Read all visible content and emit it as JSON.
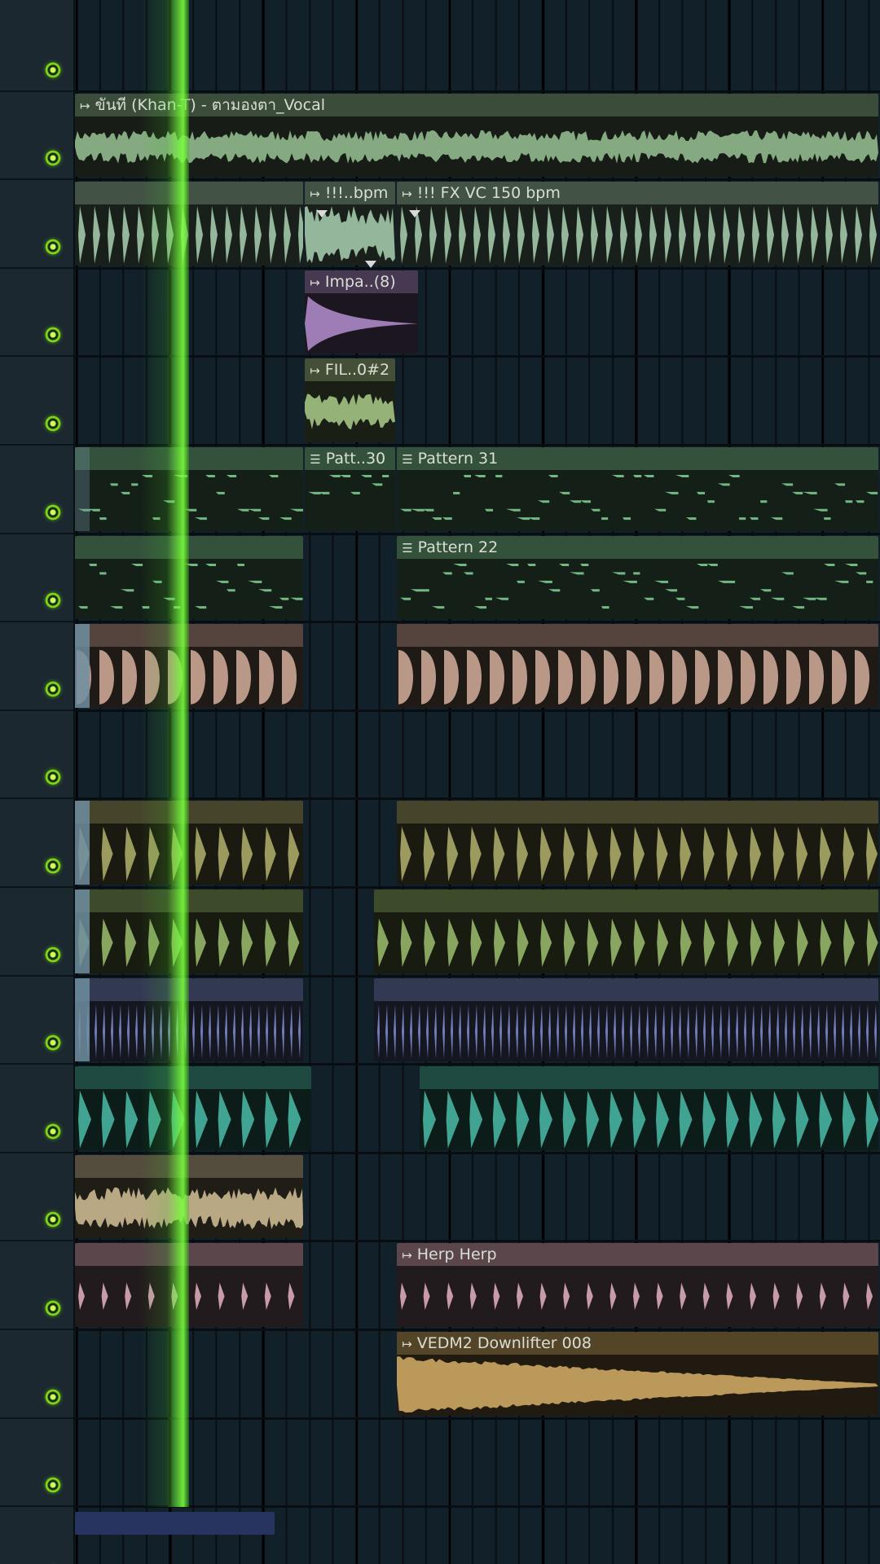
{
  "window": {
    "title": ""
  },
  "colors": {
    "vocal": "#8fb58a",
    "fx": "#9ec3a5",
    "impact": "#a987c4",
    "filter": "#9fbf82",
    "pattern_notes": "#7cc48d",
    "clap": "#c7a392",
    "kick": "#a6a566",
    "snare": "#93b266",
    "hat": "#7c87c6",
    "perc": "#47b09c",
    "noise": "#c7b48e",
    "herp": "#d6a6b3",
    "downlifter": "#c9a462",
    "playhead": "#5fe030"
  },
  "tracks": [
    {
      "clips": []
    },
    {
      "clips": [
        {
          "label": "ขันที (Khan-T) - ตามองตา_Vocal",
          "icon": "audio-clip-icon",
          "start": 0,
          "end": 1,
          "color": "vocal"
        }
      ]
    },
    {
      "clips": [
        {
          "label": "",
          "icon": "audio-clip-icon",
          "start": 0,
          "end": 0.2857,
          "color": "fx"
        },
        {
          "label": "!!!..bpm",
          "icon": "audio-clip-icon",
          "start": 0.2857,
          "end": 0.4,
          "color": "fx"
        },
        {
          "label": "!!! FX VC 150 bpm",
          "icon": "audio-clip-icon",
          "start": 0.4,
          "end": 1,
          "color": "fx"
        }
      ]
    },
    {
      "clips": [
        {
          "label": "Impa..(8)",
          "icon": "audio-clip-icon",
          "start": 0.2857,
          "end": 0.4286,
          "color": "impact"
        }
      ]
    },
    {
      "clips": [
        {
          "label": "FIL..0#2",
          "icon": "audio-clip-icon",
          "start": 0.2857,
          "end": 0.4,
          "color": "filter"
        }
      ]
    },
    {
      "clips": [
        {
          "label": "",
          "icon": "pattern-clip-icon",
          "start": 0,
          "end": 0.2857,
          "color": "pattern_notes"
        },
        {
          "label": "Patt..30",
          "icon": "pattern-clip-icon",
          "start": 0.2857,
          "end": 0.4,
          "color": "pattern_notes"
        },
        {
          "label": "Pattern 31",
          "icon": "pattern-clip-icon",
          "start": 0.4,
          "end": 1,
          "color": "pattern_notes"
        }
      ]
    },
    {
      "clips": [
        {
          "label": "",
          "icon": "pattern-clip-icon",
          "start": 0,
          "end": 0.2857,
          "color": "pattern_notes"
        },
        {
          "label": "Pattern 22",
          "icon": "pattern-clip-icon",
          "start": 0.4,
          "end": 1,
          "color": "pattern_notes"
        }
      ]
    },
    {
      "clips": [
        {
          "label": "",
          "icon": "audio-clip-icon",
          "start": 0,
          "end": 0.2857,
          "color": "clap"
        },
        {
          "label": "",
          "icon": "audio-clip-icon",
          "start": 0.4,
          "end": 1,
          "color": "clap"
        }
      ]
    },
    {
      "clips": []
    },
    {
      "clips": [
        {
          "label": "",
          "icon": "audio-clip-icon",
          "start": 0,
          "end": 0.2857,
          "color": "kick"
        },
        {
          "label": "",
          "icon": "audio-clip-icon",
          "start": 0.4,
          "end": 1,
          "color": "kick"
        }
      ]
    },
    {
      "clips": [
        {
          "label": "",
          "icon": "audio-clip-icon",
          "start": 0,
          "end": 0.2857,
          "color": "snare"
        },
        {
          "label": "",
          "icon": "audio-clip-icon",
          "start": 0.3714,
          "end": 1,
          "color": "snare"
        }
      ]
    },
    {
      "clips": [
        {
          "label": "",
          "icon": "audio-clip-icon",
          "start": 0,
          "end": 0.2857,
          "color": "hat"
        },
        {
          "label": "",
          "icon": "audio-clip-icon",
          "start": 0.3714,
          "end": 1,
          "color": "hat"
        }
      ]
    },
    {
      "clips": [
        {
          "label": "",
          "icon": "audio-clip-icon",
          "start": 0,
          "end": 0.2952,
          "color": "perc"
        },
        {
          "label": "",
          "icon": "audio-clip-icon",
          "start": 0.4286,
          "end": 1,
          "color": "perc"
        }
      ]
    },
    {
      "clips": [
        {
          "label": "",
          "icon": "audio-clip-icon",
          "start": 0,
          "end": 0.2857,
          "color": "noise"
        }
      ]
    },
    {
      "clips": [
        {
          "label": "",
          "icon": "audio-clip-icon",
          "start": 0,
          "end": 0.2857,
          "color": "herp"
        },
        {
          "label": "Herp Herp",
          "icon": "audio-clip-icon",
          "start": 0.4,
          "end": 1,
          "color": "herp"
        }
      ]
    },
    {
      "clips": [
        {
          "label": "VEDM2 Downlifter 008",
          "icon": "audio-clip-icon",
          "start": 0.4,
          "end": 1,
          "color": "downlifter"
        }
      ]
    },
    {
      "clips": []
    },
    {
      "clips": []
    }
  ]
}
